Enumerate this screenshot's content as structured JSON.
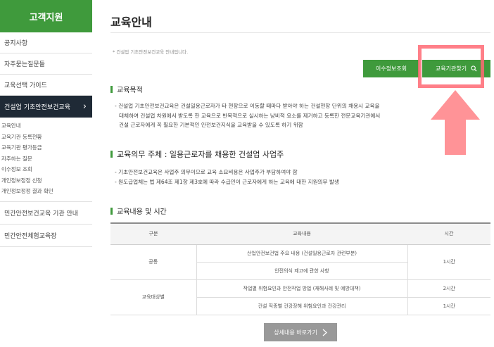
{
  "sidebar": {
    "header": "고객지원",
    "items": [
      {
        "label": "공지사항"
      },
      {
        "label": "자주묻는질문들"
      },
      {
        "label": "교육선택 가이드"
      }
    ],
    "active": {
      "label": "건설업 기초안전보건교육",
      "chevron": "›"
    },
    "sub_items": [
      {
        "label": "교육안내"
      },
      {
        "label": "교육기관 등록현황"
      },
      {
        "label": "교육기관 평가등급"
      },
      {
        "label": "자주하는 질문"
      },
      {
        "label": "이수정보 조회"
      },
      {
        "label": "개인정보정정 신청"
      },
      {
        "label": "개인정보정정 결과 확인"
      }
    ],
    "bottom_items": [
      {
        "label": "민간안전보건교육 기관 안내"
      },
      {
        "label": "민간안전체험교육장"
      }
    ]
  },
  "main": {
    "title": "교육안내",
    "note": "* 건설업 기초안전보건교육 안내입니다.",
    "buttons": {
      "history": "이수정보조회",
      "find": "교육기관찾기",
      "find_icon": "search-icon",
      "detail": "상세내용 바로가기",
      "detail_icon": "chevron-right-icon"
    },
    "sections": [
      {
        "title": "교육목적",
        "lines": [
          "- 건설업 기초안전보건교육은 건설일용근로자가 타 현장으로 이동할 때마다 받아야 하는 건설현장 단위의 채용시 교육을",
          "대체하여 건설업 차원에서 받도록 한 교육으로 반복적으로 실시하는 낭비적 요소를 제거하고 등록한 전문교육기관에서",
          "건설 근로자에게 꼭 필요한 기본적인 안전보건지식을 교육받을 수 있도록 하기 위함"
        ]
      },
      {
        "title": "교육의무 주체 : 일용근로자를 채용한 건설업 사업주",
        "lines": [
          "- 기초안전보건교육은 사업주 의무이므로 교육 소요비용은 사업주가 부담하여야 함",
          "- 원도급업체는 법 제64조 제1항 제3호에 따라 수급인이 근로자에게 하는 교육에 대한 지원의무 발생"
        ]
      },
      {
        "title": "교육내용 및 시간"
      }
    ],
    "table": {
      "headers": [
        "구분",
        "교육내용",
        "시간"
      ],
      "groups": [
        {
          "category": "공통",
          "time": "1시간",
          "rows": [
            "산업안전보건법 주요 내용 (건설일용근로자 관련부분)",
            "안전의식 제고에 관한 사항"
          ]
        },
        {
          "category": "교육대상별",
          "time": "",
          "rows": [
            "작업별 위험요인과 안전작업 방법 (재해사례 및 예방대책)",
            "건설 직종별 건강장해 위험요인과 건강관리"
          ],
          "times": [
            "2시간",
            "1시간"
          ]
        }
      ]
    }
  },
  "annotation": {
    "highlight_color": "#ff6973"
  },
  "colors": {
    "accent": "#3f9a3c",
    "active_nav": "#1f2a36",
    "detail_button": "#999999"
  }
}
